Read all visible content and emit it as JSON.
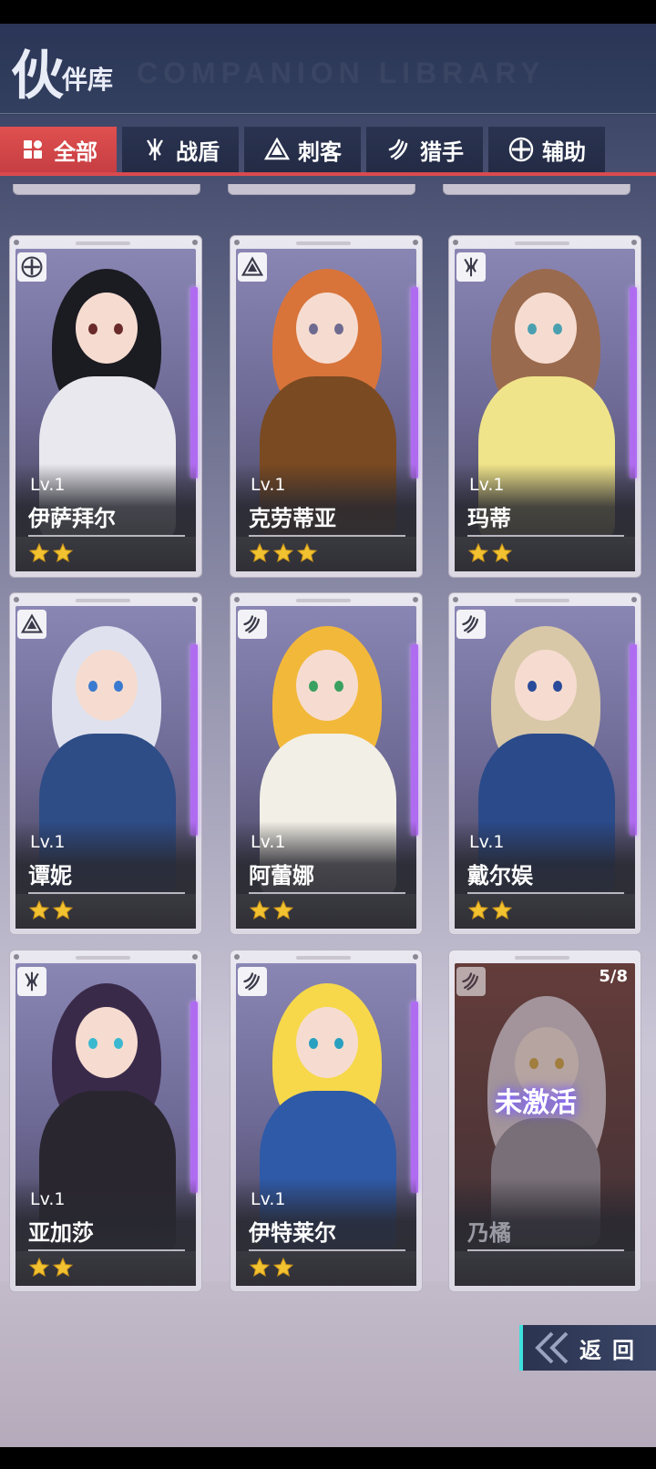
{
  "header": {
    "title_big": "伙",
    "title_small": "伴库"
  },
  "tabs": [
    {
      "label": "全部",
      "icon": "grid-icon",
      "active": true
    },
    {
      "label": "战盾",
      "icon": "shield-class-icon",
      "active": false
    },
    {
      "label": "刺客",
      "icon": "assassin-class-icon",
      "active": false
    },
    {
      "label": "猎手",
      "icon": "hunter-class-icon",
      "active": false
    },
    {
      "label": "辅助",
      "icon": "support-class-icon",
      "active": false
    }
  ],
  "cards": [
    {
      "level": "Lv.1",
      "name": "伊萨拜尔",
      "stars": 2,
      "role_icon": "support-class-icon",
      "hair": "#1b1b22",
      "outfit": "#e9e8ee",
      "eye": "#6a2a2a"
    },
    {
      "level": "Lv.1",
      "name": "克劳蒂亚",
      "stars": 3,
      "role_icon": "assassin-class-icon",
      "hair": "#d8743a",
      "outfit": "#7a4a22",
      "eye": "#6e6a90"
    },
    {
      "level": "Lv.1",
      "name": "玛蒂",
      "stars": 2,
      "role_icon": "shield-class-icon",
      "hair": "#9a6a4e",
      "outfit": "#f0e48a",
      "eye": "#4aa0b0"
    },
    {
      "level": "Lv.1",
      "name": "谭妮",
      "stars": 2,
      "role_icon": "assassin-class-icon",
      "hair": "#dfe2ee",
      "outfit": "#2e4c86",
      "eye": "#3a7ad0"
    },
    {
      "level": "Lv.1",
      "name": "阿蕾娜",
      "stars": 2,
      "role_icon": "hunter-class-icon",
      "hair": "#f2b83a",
      "outfit": "#f2efe6",
      "eye": "#3aa060"
    },
    {
      "level": "Lv.1",
      "name": "戴尔娱",
      "stars": 2,
      "role_icon": "hunter-class-icon",
      "hair": "#d8c8a8",
      "outfit": "#2a4a8a",
      "eye": "#2a4a9a"
    },
    {
      "level": "Lv.1",
      "name": "亚加莎",
      "stars": 2,
      "role_icon": "shield-class-icon",
      "hair": "#3a2a4a",
      "outfit": "#2a2630",
      "eye": "#3ab8d0"
    },
    {
      "level": "Lv.1",
      "name": "伊特莱尔",
      "stars": 2,
      "role_icon": "hunter-class-icon",
      "hair": "#f6d84a",
      "outfit": "#2f5aa8",
      "eye": "#2aa0c0"
    }
  ],
  "locked_card": {
    "name": "乃橘",
    "status": "未激活",
    "shards": "5/8",
    "role_icon": "hunter-class-icon"
  },
  "return_button": {
    "label": "返回"
  },
  "colors": {
    "accent_red": "#d84a4e",
    "level_bar": "#b06cf0",
    "star": "#f2c230",
    "return_edge": "#3fe0e0"
  }
}
